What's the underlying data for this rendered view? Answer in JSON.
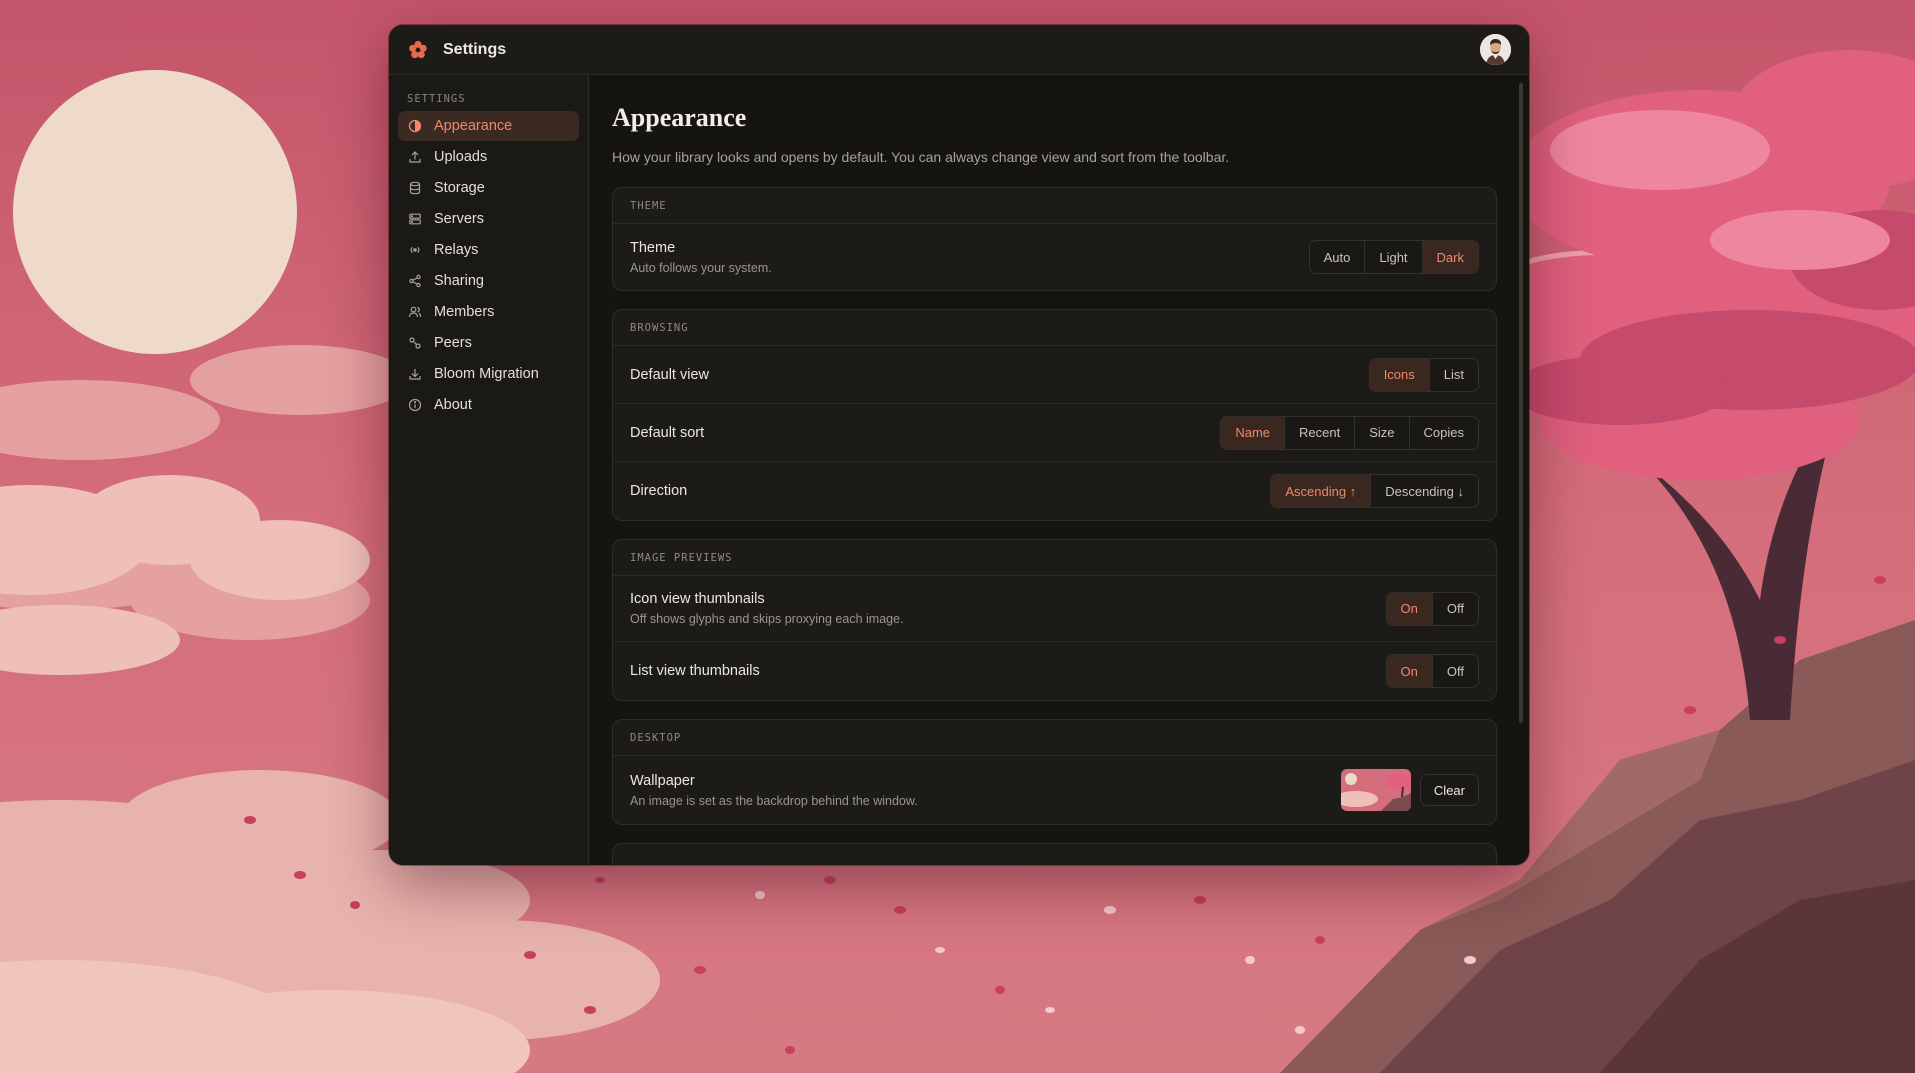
{
  "window": {
    "title": "Settings",
    "logo_icon": "flower-logo-icon",
    "avatar_icon": "user-avatar"
  },
  "sidebar": {
    "heading": "SETTINGS",
    "items": [
      {
        "label": "Appearance",
        "icon": "contrast-icon",
        "active": true
      },
      {
        "label": "Uploads",
        "icon": "upload-icon"
      },
      {
        "label": "Storage",
        "icon": "database-icon"
      },
      {
        "label": "Servers",
        "icon": "server-icon"
      },
      {
        "label": "Relays",
        "icon": "radio-icon"
      },
      {
        "label": "Sharing",
        "icon": "share-icon"
      },
      {
        "label": "Members",
        "icon": "members-icon"
      },
      {
        "label": "Peers",
        "icon": "peers-icon"
      },
      {
        "label": "Bloom Migration",
        "icon": "download-icon"
      },
      {
        "label": "About",
        "icon": "info-icon"
      }
    ]
  },
  "main": {
    "title": "Appearance",
    "description": "How your library looks and opens by default. You can always change view and sort from the toolbar.",
    "theme": {
      "heading": "THEME",
      "label": "Theme",
      "sub": "Auto follows your system.",
      "options": [
        "Auto",
        "Light",
        "Dark"
      ],
      "selected": "Dark"
    },
    "browsing": {
      "heading": "BROWSING",
      "default_view": {
        "label": "Default view",
        "options": [
          "Icons",
          "List"
        ],
        "selected": "Icons"
      },
      "default_sort": {
        "label": "Default sort",
        "options": [
          "Name",
          "Recent",
          "Size",
          "Copies"
        ],
        "selected": "Name"
      },
      "direction": {
        "label": "Direction",
        "options": [
          "Ascending ↑",
          "Descending ↓"
        ],
        "selected": "Ascending ↑"
      }
    },
    "image_previews": {
      "heading": "IMAGE PREVIEWS",
      "icon_thumbs": {
        "label": "Icon view thumbnails",
        "sub": "Off shows glyphs and skips proxying each image.",
        "options": [
          "On",
          "Off"
        ],
        "selected": "On"
      },
      "list_thumbs": {
        "label": "List view thumbnails",
        "options": [
          "On",
          "Off"
        ],
        "selected": "On"
      }
    },
    "desktop": {
      "heading": "DESKTOP",
      "wallpaper": {
        "label": "Wallpaper",
        "sub": "An image is set as the backdrop behind the window.",
        "clear_label": "Clear"
      }
    }
  },
  "colors": {
    "accent": "#f0886a",
    "accent_bg": "#3a2820",
    "window_bg": "#1b1915",
    "wallpaper_sky": "#d46a7a"
  }
}
